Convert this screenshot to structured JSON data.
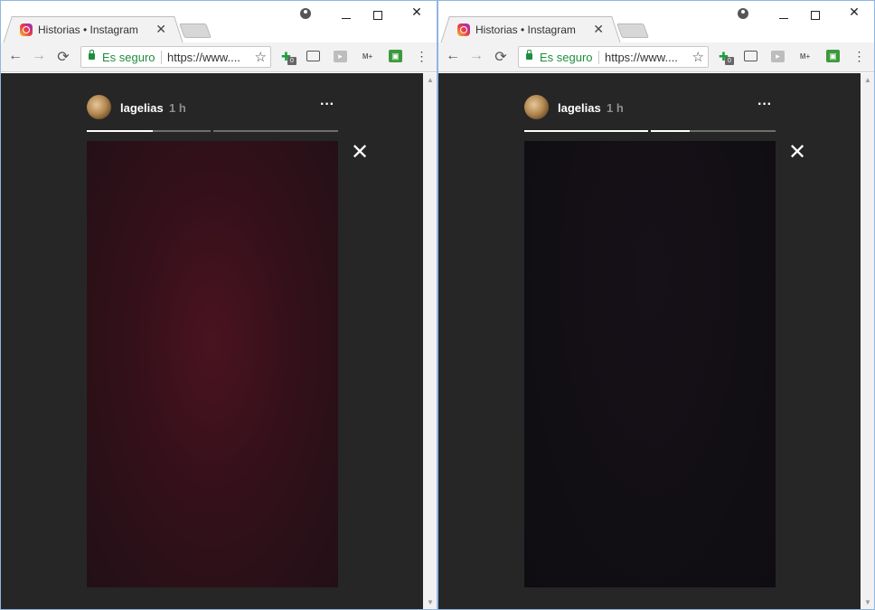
{
  "windows": [
    {
      "tab": {
        "title": "Historias • Instagram",
        "close": "✕"
      },
      "window_controls": {
        "minimize": "—",
        "close": "✕"
      },
      "toolbar": {
        "back": "←",
        "forward": "→",
        "reload": "⟳",
        "secure_label": "Es seguro",
        "url": "https://www....",
        "star": "☆",
        "ext_badge": "0",
        "ext_mplus": "M+",
        "menu": "⋮"
      },
      "story": {
        "username": "lagelias",
        "time": "1 h",
        "more": "···",
        "close": "✕",
        "progress": [
          0.53,
          0.0
        ]
      }
    },
    {
      "tab": {
        "title": "Historias • Instagram",
        "close": "✕"
      },
      "window_controls": {
        "minimize": "—",
        "close": "✕"
      },
      "toolbar": {
        "back": "←",
        "forward": "→",
        "reload": "⟳",
        "secure_label": "Es seguro",
        "url": "https://www....",
        "star": "☆",
        "ext_badge": "0",
        "ext_mplus": "M+",
        "menu": "⋮"
      },
      "story": {
        "username": "lagelias",
        "time": "1 h",
        "more": "···",
        "close": "✕",
        "progress": [
          1.0,
          0.31
        ]
      }
    }
  ]
}
